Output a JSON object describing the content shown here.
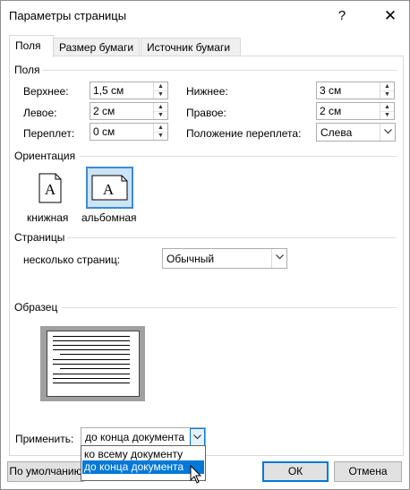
{
  "window": {
    "title": "Параметры страницы",
    "help_glyph": "?",
    "close_glyph": "✕"
  },
  "tabs": [
    {
      "label": "Поля",
      "active": true
    },
    {
      "label": "Размер бумаги",
      "active": false
    },
    {
      "label": "Источник бумаги",
      "active": false
    }
  ],
  "margins": {
    "group_title": "Поля",
    "top": {
      "label": "Верхнее:",
      "value": "1,5 см"
    },
    "left": {
      "label": "Левое:",
      "value": "2 см"
    },
    "gutter": {
      "label": "Переплет:",
      "value": "0 см"
    },
    "bottom": {
      "label": "Нижнее:",
      "value": "3 см"
    },
    "right": {
      "label": "Правое:",
      "value": "2 см"
    },
    "gutter_position": {
      "label": "Положение переплета:",
      "value": "Слева"
    }
  },
  "orientation": {
    "group_title": "Ориентация",
    "portrait_label": "книжная",
    "landscape_label": "альбомная",
    "icon_letter": "A",
    "selected": "landscape"
  },
  "pages": {
    "group_title": "Страницы",
    "multiple_label": "несколько страниц:",
    "multiple_value": "Обычный"
  },
  "preview": {
    "group_title": "Образец"
  },
  "apply": {
    "label": "Применить:",
    "value": "до конца документа",
    "options": [
      "ко всему документу",
      "до конца документа"
    ],
    "highlighted_index": 1
  },
  "buttons": {
    "default_label": "По умолчанию",
    "ok_label": "ОК",
    "cancel_label": "Отмена"
  },
  "colors": {
    "accent": "#0078d7",
    "selected_bg": "#cce4f7"
  }
}
